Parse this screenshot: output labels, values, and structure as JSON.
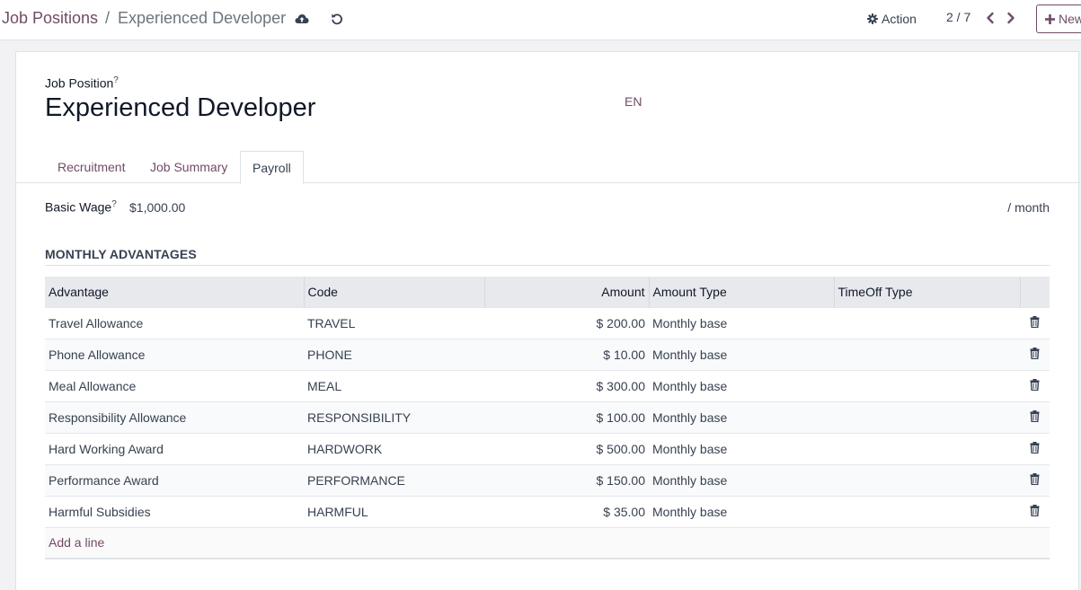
{
  "breadcrumb": {
    "root": "Job Positions",
    "separator": "/",
    "current": "Experienced Developer"
  },
  "toolbar": {
    "action_label": "Action",
    "pager_value": "2 / 7",
    "new_label": "New"
  },
  "form": {
    "title_label": "Job Position",
    "help_mark": "?",
    "title_value": "Experienced Developer",
    "lang": "EN"
  },
  "tabs": [
    {
      "label": "Recruitment",
      "active": false
    },
    {
      "label": "Job Summary",
      "active": false
    },
    {
      "label": "Payroll",
      "active": true
    }
  ],
  "payroll": {
    "wage_label": "Basic Wage",
    "wage_value": "$1,000.00",
    "wage_unit": "/ month",
    "section_title": "MONTHLY ADVANTAGES",
    "columns": [
      "Advantage",
      "Code",
      "Amount",
      "Amount Type",
      "TimeOff Type"
    ],
    "rows": [
      {
        "advantage": "Travel Allowance",
        "code": "TRAVEL",
        "amount": "$ 200.00",
        "amount_type": "Monthly base",
        "timeoff_type": ""
      },
      {
        "advantage": "Phone Allowance",
        "code": "PHONE",
        "amount": "$ 10.00",
        "amount_type": "Monthly base",
        "timeoff_type": ""
      },
      {
        "advantage": "Meal Allowance",
        "code": "MEAL",
        "amount": "$ 300.00",
        "amount_type": "Monthly base",
        "timeoff_type": ""
      },
      {
        "advantage": "Responsibility Allowance",
        "code": "RESPONSIBILITY",
        "amount": "$ 100.00",
        "amount_type": "Monthly base",
        "timeoff_type": ""
      },
      {
        "advantage": "Hard Working Award",
        "code": "HARDWORK",
        "amount": "$ 500.00",
        "amount_type": "Monthly base",
        "timeoff_type": ""
      },
      {
        "advantage": "Performance Award",
        "code": "PERFORMANCE",
        "amount": "$ 150.00",
        "amount_type": "Monthly base",
        "timeoff_type": ""
      },
      {
        "advantage": "Harmful Subsidies",
        "code": "HARMFUL",
        "amount": "$ 35.00",
        "amount_type": "Monthly base",
        "timeoff_type": ""
      }
    ],
    "add_line_label": "Add a line"
  },
  "colors": {
    "brand": "#714b67",
    "text": "#374151",
    "header_bg": "#e7e9ed"
  },
  "icons": {
    "save": "cloud-upload-icon",
    "discard": "undo-icon",
    "action": "gear-icon",
    "prev": "chevron-left-icon",
    "next": "chevron-right-icon",
    "new": "plus-icon",
    "delete": "trash-icon"
  }
}
